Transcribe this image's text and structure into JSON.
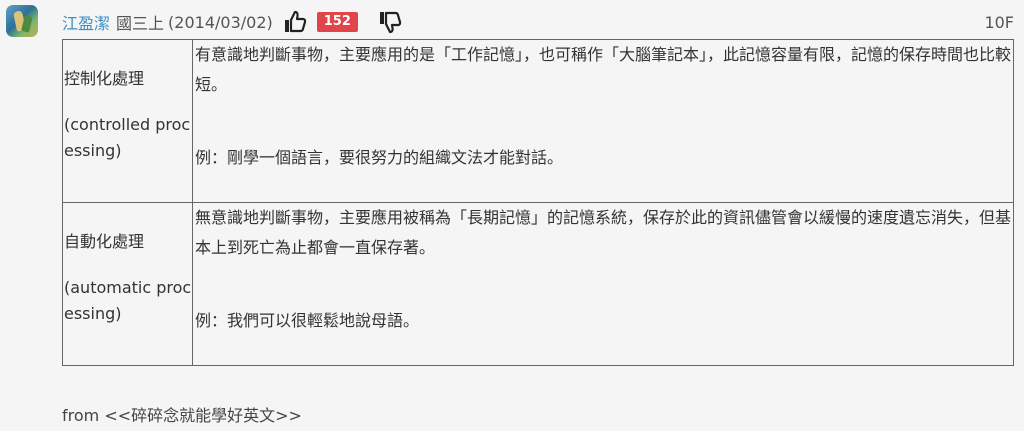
{
  "post": {
    "author": "江盈潔",
    "grade": "國三上",
    "date": "(2014/03/02)",
    "like_count": "152",
    "floor": "10F",
    "icons": {
      "avatar": "user-avatar",
      "like": "thumbs-up-icon",
      "dislike": "thumbs-down-icon"
    },
    "colors": {
      "author_link": "#3a8fc6",
      "like_badge": "#e0454c"
    }
  },
  "table": {
    "rows": [
      {
        "term_cn": "控制化處理",
        "term_en": "(controlled processing)",
        "description": "有意識地判斷事物，主要應用的是「工作記憶」，也可稱作「大腦筆記本」，此記憶容量有限，記憶的保存時間也比較短。",
        "example": "例：剛學一個語言，要很努力的組織文法才能對話。"
      },
      {
        "term_cn": "自動化處理",
        "term_en": "(automatic processing)",
        "description": "無意識地判斷事物，主要應用被稱為「長期記憶」的記憶系統，保存於此的資訊儘管會以緩慢的速度遺忘消失，但基本上到死亡為止都會一直保存著。",
        "example": "例：我們可以很輕鬆地說母語。"
      }
    ]
  },
  "footer": {
    "source": "from <<碎碎念就能學好英文>>"
  }
}
